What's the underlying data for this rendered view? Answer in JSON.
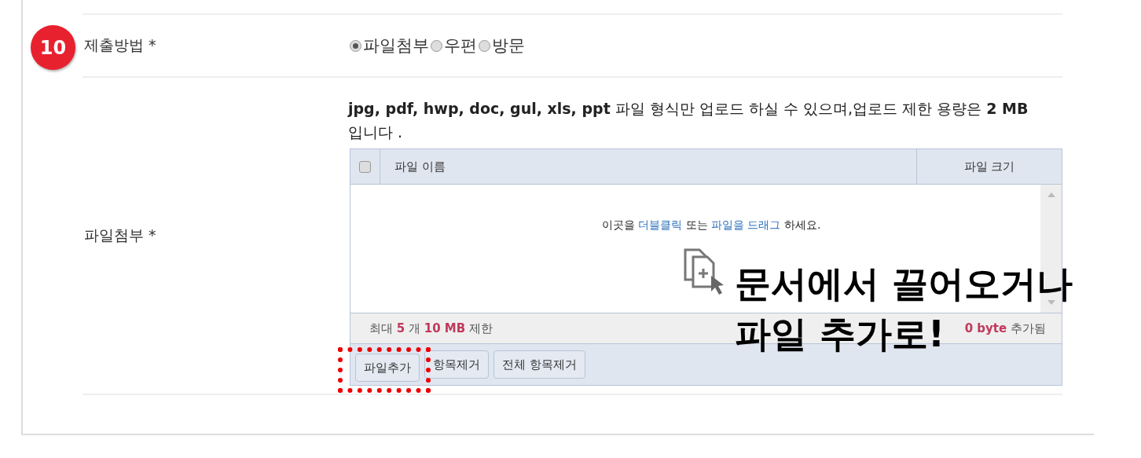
{
  "method": {
    "number": "10",
    "label": "제출방법 *",
    "options": [
      {
        "label": "파일첨부",
        "selected": true
      },
      {
        "label": "우편",
        "selected": false
      },
      {
        "label": "방문",
        "selected": false
      }
    ]
  },
  "attachment": {
    "label": "파일첨부 *",
    "notice": "**jpg, pdf, hwp, doc, gul, xls, ppt** 파일 형식만 업로드 하실 수 있으며,업로드 제한 용량은 **2 MB** 입니다 .",
    "table": {
      "all_checked": false,
      "columns": [
        "파일 이름",
        "파일 크기"
      ],
      "drop_hint": [
        {
          "text": "이곳을 ",
          "link": false
        },
        {
          "text": "더블클릭",
          "link": true
        },
        {
          "text": " 또는 ",
          "link": false
        },
        {
          "text": "파일을 드래그",
          "link": true
        },
        {
          "text": " 하세요.",
          "link": false
        }
      ],
      "limit": "최대 **5** 개 **10 MB** 제한",
      "added": "**0 byte** 추가됨"
    },
    "buttons": [
      {
        "label": "파일추가",
        "highlighted": true
      },
      {
        "label": "항목제거",
        "highlighted": false
      },
      {
        "label": "전체 항목제거",
        "highlighted": false
      }
    ]
  },
  "annotation": [
    "문서에서 끌어오거나",
    "파일 추가로!"
  ]
}
